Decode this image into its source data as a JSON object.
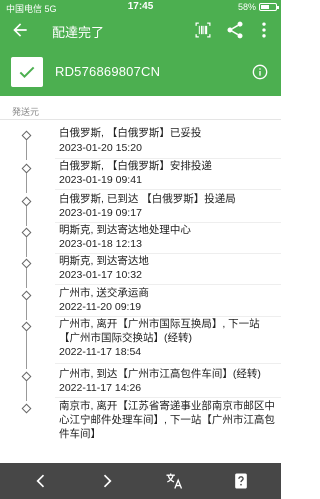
{
  "status_bar": {
    "carrier": "中国电信",
    "network": "5G",
    "time": "17:45",
    "battery": "58%",
    "battery_level": 0.58
  },
  "app_bar": {
    "title": "配達完了",
    "icons": [
      "arrow-left-icon",
      "barcode-icon",
      "share-icon",
      "more-vert-icon"
    ]
  },
  "header": {
    "tracking_number": "RD576869807CN",
    "status_icon": "check-icon",
    "info_icon": "info-icon"
  },
  "section_label": "発送元",
  "events": [
    {
      "desc": "白俄罗斯, 【白俄罗斯】已妥投",
      "time": "2023-01-20 15:20"
    },
    {
      "desc": "白俄罗斯, 【白俄罗斯】安排投递",
      "time": "2023-01-19 09:41"
    },
    {
      "desc": "白俄罗斯, 已到达 【白俄罗斯】投递局",
      "time": "2023-01-19 09:17"
    },
    {
      "desc": "明斯克, 到达寄达地处理中心",
      "time": "2023-01-18 12:13"
    },
    {
      "desc": "明斯克, 到达寄达地",
      "time": "2023-01-17 10:32"
    },
    {
      "desc": "广州市, 送交承运商",
      "time": "2022-11-20 09:19"
    },
    {
      "desc": "广州市, 离开【广州市国际互换局】, 下一站【广州市国际交换站】(经转)",
      "time": "2022-11-17 18:54"
    },
    {
      "desc": "广州市, 到达【广州市江高包件车间】(经转)",
      "time": "2022-11-17 14:26"
    },
    {
      "desc": "南京市, 离开【江苏省寄递事业部南京市邮区中心江宁邮件处理车间】, 下一站【广州市江高包件车间】",
      "time": ""
    }
  ],
  "bottom_bar": {
    "icons": [
      "chevron-left-icon",
      "chevron-right-icon",
      "translate-icon",
      "help-icon"
    ]
  }
}
